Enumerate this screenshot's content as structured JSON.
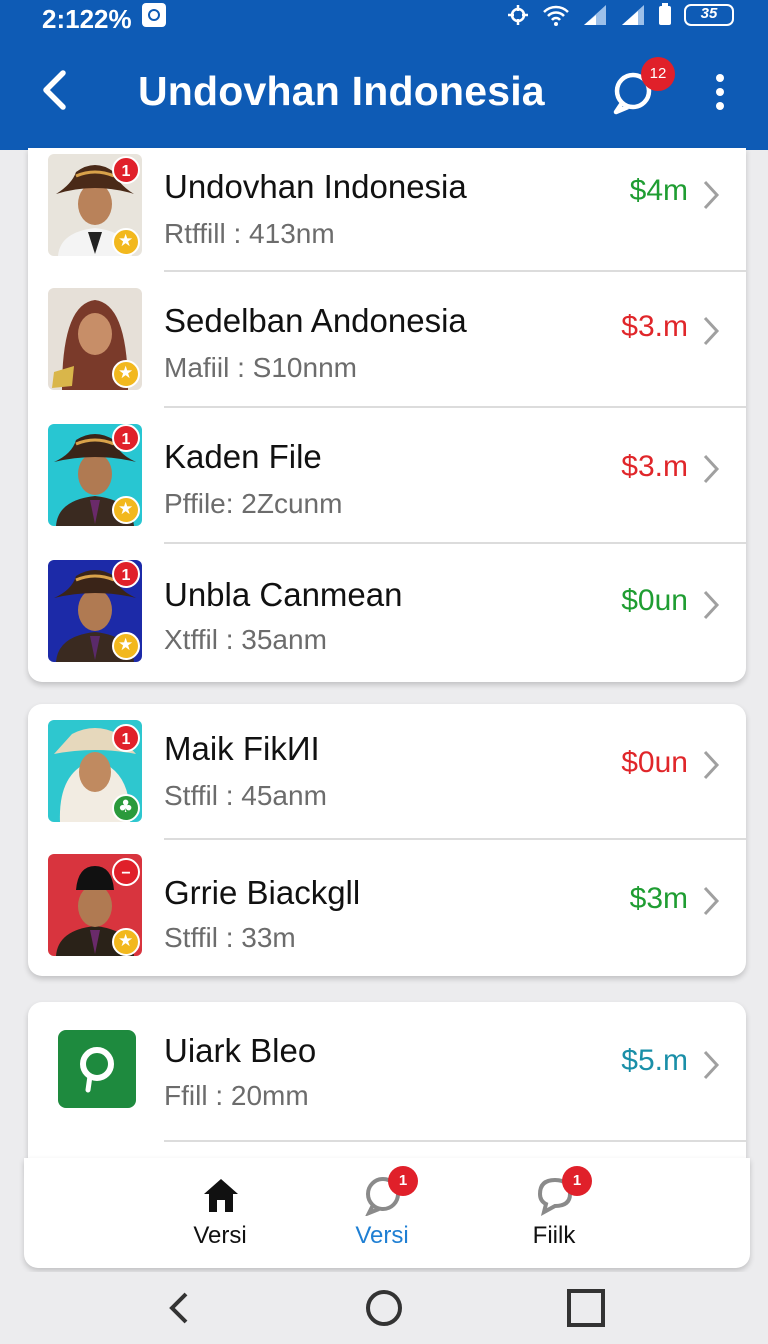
{
  "status": {
    "time": "2:1",
    "percent": "22%",
    "battery": "35"
  },
  "header": {
    "title": "Undovhan Indonesia",
    "chat_badge": "12"
  },
  "list": [
    {
      "title": "Undovhan Indonesia",
      "subtitle": "Rtffill : 413nm",
      "amount": "$4m",
      "amount_color": "#1f9d32",
      "badge": "1",
      "badge_icon": "star-icon"
    },
    {
      "title": "Sedelban Andonesia",
      "subtitle": "Mafiil : S10nnm",
      "amount": "$3.m",
      "amount_color": "#e0262a",
      "badge": "",
      "badge_icon": "star-icon"
    },
    {
      "title": "Kaden File",
      "subtitle": "Pffile: 2Zcunm",
      "amount": "$3.m",
      "amount_color": "#e0262a",
      "badge": "1",
      "badge_icon": "star-icon"
    },
    {
      "title": "Unbla Canmean",
      "subtitle": "Xtffil : 35anm",
      "amount": "$0un",
      "amount_color": "#1f9d32",
      "badge": "1",
      "badge_icon": "star-icon"
    },
    {
      "title": "Maik FikИI",
      "subtitle": "Stffil : 45anm",
      "amount": "$0un",
      "amount_color": "#e0262a",
      "badge": "1",
      "badge_icon": "clover-icon"
    },
    {
      "title": "Grrie Biackgll",
      "subtitle": "Stffil : 33m",
      "amount": "$3m",
      "amount_color": "#1f9d32",
      "badge": "−",
      "badge_icon": "star-icon"
    },
    {
      "title": "Uiark Bleo",
      "subtitle": "Ffill  : 20mm",
      "amount": "$5.m",
      "amount_color": "#1a8fa8",
      "badge": "",
      "badge_icon": ""
    }
  ],
  "bottom_nav": [
    {
      "label": "Versi",
      "icon": "home-icon",
      "badge": "",
      "active": false
    },
    {
      "label": "Versi",
      "icon": "chat-icon",
      "badge": "1",
      "active": true
    },
    {
      "label": "Fiilk",
      "icon": "comment-icon",
      "badge": "1",
      "active": false
    }
  ],
  "colors": {
    "primary": "#0e5bb5",
    "active_nav": "#1f7fd3",
    "badge": "#e0202a"
  }
}
